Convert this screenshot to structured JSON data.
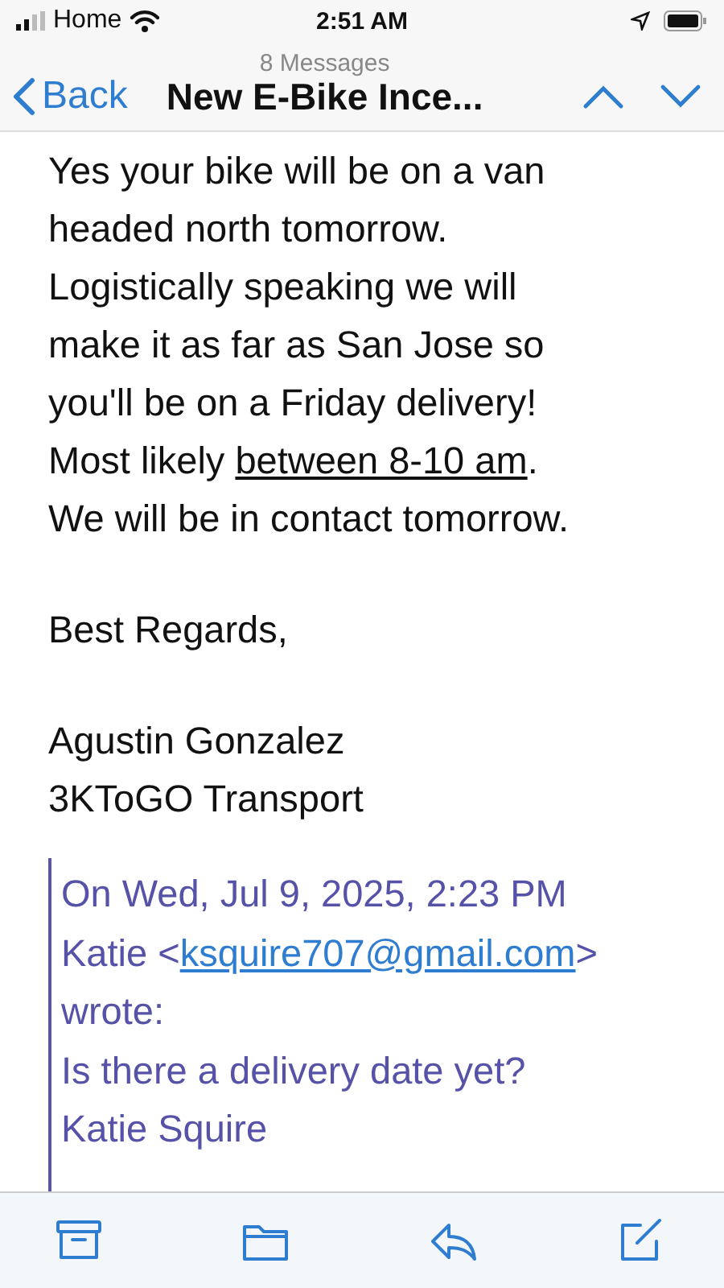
{
  "status_bar": {
    "carrier": "Home",
    "time": "2:51 AM"
  },
  "nav": {
    "back": "Back",
    "subtitle": "8 Messages",
    "title": "New E-Bike Ince..."
  },
  "body": {
    "paragraphs": [
      [
        [
          {
            "kind": "text",
            "text": "Yes your bike will be on a van"
          }
        ],
        [
          {
            "kind": "text",
            "text": "headed north tomorrow."
          }
        ],
        [
          {
            "kind": "text",
            "text": "Logistically speaking we will"
          }
        ],
        [
          {
            "kind": "text",
            "text": "make it as far as San Jose so"
          }
        ],
        [
          {
            "kind": "text",
            "text": "you'll be on a Friday delivery!"
          }
        ],
        [
          {
            "kind": "text",
            "text": "Most likely "
          },
          {
            "kind": "link",
            "text": "between 8-10 am"
          },
          {
            "kind": "text",
            "text": "."
          }
        ],
        [
          {
            "kind": "text",
            "text": "We will be in contact tomorrow."
          }
        ]
      ],
      [
        [
          {
            "kind": "text",
            "text": "Best Regards,"
          }
        ]
      ],
      [
        [
          {
            "kind": "text",
            "text": "Agustin Gonzalez"
          }
        ],
        [
          {
            "kind": "text",
            "text": "3KToGO Transport"
          }
        ]
      ]
    ]
  },
  "quote": {
    "paragraphs": [
      [
        [
          {
            "kind": "text",
            "text": "On Wed, Jul 9, 2025, 2:23 PM"
          }
        ],
        [
          {
            "kind": "text",
            "text": "Katie <"
          },
          {
            "kind": "link",
            "text": "ksquire707@gmail.com"
          },
          {
            "kind": "text",
            "text": ">"
          }
        ],
        [
          {
            "kind": "text",
            "text": "wrote:"
          }
        ]
      ],
      [
        [
          {
            "kind": "text",
            "text": "Is there a delivery date yet?"
          }
        ]
      ],
      [
        [
          {
            "kind": "text",
            "text": "Katie Squire"
          }
        ]
      ]
    ]
  },
  "toolbar": [
    {
      "kind": "archive"
    },
    {
      "kind": "folder"
    },
    {
      "kind": "reply"
    },
    {
      "kind": "compose"
    }
  ]
}
